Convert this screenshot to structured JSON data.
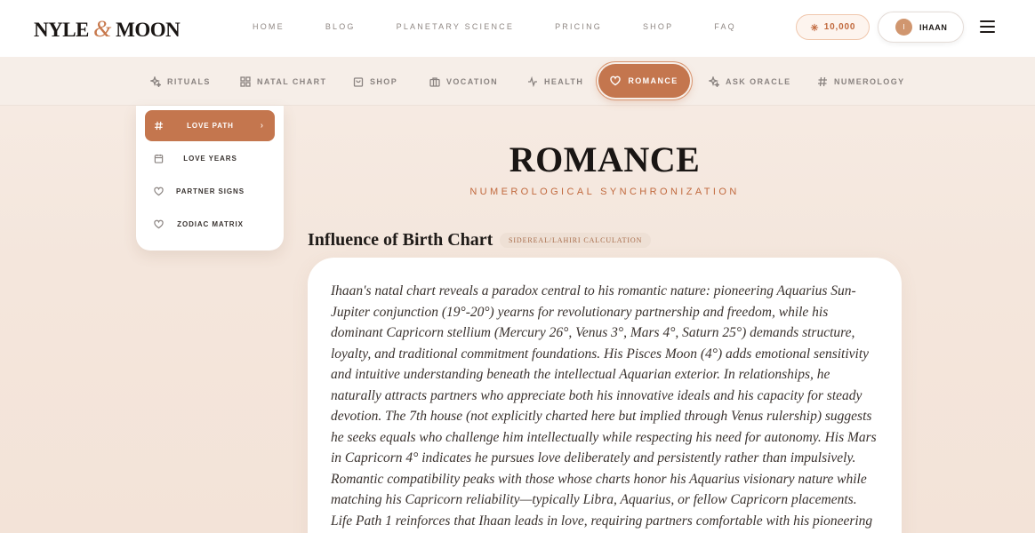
{
  "brand": {
    "part1": "NYLE",
    "amp": "&",
    "part2": "MOON"
  },
  "topnav": [
    "HOME",
    "BLOG",
    "PLANETARY SCIENCE",
    "PRICING",
    "SHOP",
    "FAQ"
  ],
  "credits": {
    "value": "10,000",
    "icon": "sparkle-icon"
  },
  "user": {
    "initial": "I",
    "name": "IHAAN"
  },
  "subnav": {
    "items": [
      {
        "label": "RITUALS",
        "icon": "sparkle-icon"
      },
      {
        "label": "NATAL CHART",
        "icon": "grid-icon"
      },
      {
        "label": "SHOP",
        "icon": "bag-icon"
      },
      {
        "label": "VOCATION",
        "icon": "briefcase-icon"
      },
      {
        "label": "HEALTH",
        "icon": "pulse-icon"
      },
      {
        "label": "ROMANCE",
        "icon": "heart-icon",
        "active": true
      },
      {
        "label": "ASK ORACLE",
        "icon": "sparkle-icon"
      },
      {
        "label": "NUMEROLOGY",
        "icon": "hash-icon"
      }
    ]
  },
  "side": {
    "items": [
      {
        "label": "LOVE PATH",
        "icon": "hash-icon",
        "active": true
      },
      {
        "label": "LOVE YEARS",
        "icon": "calendar-icon"
      },
      {
        "label": "PARTNER SIGNS",
        "icon": "heart-icon"
      },
      {
        "label": "ZODIAC MATRIX",
        "icon": "heart-icon"
      }
    ]
  },
  "main": {
    "title": "ROMANCE",
    "subtitle": "NUMEROLOGICAL SYNCHRONIZATION",
    "section_heading": "Influence of Birth Chart",
    "badge": "SIDEREAL/LAHIRI CALCULATION",
    "body": "Ihaan's natal chart reveals a paradox central to his romantic nature: pioneering Aquarius Sun-Jupiter conjunction (19°-20°) yearns for revolutionary partnership and freedom, while his dominant Capricorn stellium (Mercury 26°, Venus 3°, Mars 4°, Saturn 25°) demands structure, loyalty, and traditional commitment foundations. His Pisces Moon (4°) adds emotional sensitivity and intuitive understanding beneath the intellectual Aquarian exterior. In relationships, he naturally attracts partners who appreciate both his innovative ideals and his capacity for steady devotion. The 7th house (not explicitly charted here but implied through Venus rulership) suggests he seeks equals who challenge him intellectually while respecting his need for autonomy. His Mars in Capricorn 4° indicates he pursues love deliberately and persistently rather than impulsively. Romantic compatibility peaks with those whose charts honor his Aquarius visionary nature while matching his Capricorn reliability—typically Libra, Aquarius, or fellow Capricorn placements. Life Path 1 reinforces that Ihaan leads in love, requiring partners comfortable with his pioneering spirit"
  },
  "colors": {
    "accent": "#c4764e",
    "accent_text": "#c1693d"
  }
}
